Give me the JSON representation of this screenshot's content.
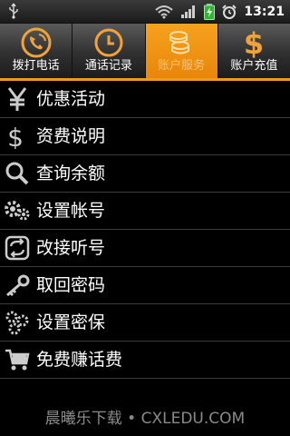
{
  "status_bar": {
    "time": "13:21",
    "icons": [
      "usb-icon",
      "wifi-icon",
      "signal-icon",
      "battery-charging-icon",
      "alarm-icon"
    ]
  },
  "tabs": [
    {
      "label": "拨打电话",
      "icon": "phone-icon",
      "active": false
    },
    {
      "label": "通话记录",
      "icon": "clock-icon",
      "active": false
    },
    {
      "label": "账户服务",
      "icon": "coins-icon",
      "active": true
    },
    {
      "label": "账户充值",
      "icon": "dollar-icon",
      "active": false
    }
  ],
  "menu": {
    "items": [
      {
        "label": "优惠活动",
        "icon": "yen-icon"
      },
      {
        "label": "资费说明",
        "icon": "dollar-sign-icon"
      },
      {
        "label": "查询余额",
        "icon": "magnifier-icon"
      },
      {
        "label": "设置帐号",
        "icon": "gears-icon"
      },
      {
        "label": "改接听号",
        "icon": "swap-icon"
      },
      {
        "label": "取回密码",
        "icon": "key-icon"
      },
      {
        "label": "设置密保",
        "icon": "gear-people-icon"
      },
      {
        "label": "免费赚话费",
        "icon": "cart-icon"
      }
    ]
  },
  "watermark": "晨曦乐下载 • CXLEDU.COM",
  "colors": {
    "accent": "#f39a14",
    "background": "#000000",
    "divider": "#3a3a3a"
  }
}
